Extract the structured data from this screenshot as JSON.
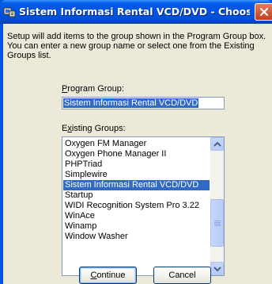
{
  "window": {
    "title": "Sistem Informasi Rental VCD/DVD - Choose Progr...",
    "close_label": "X"
  },
  "description": "Setup will add items to the group shown in the Program Group box. You can enter a new group name or select one from the Existing Groups list.",
  "program_group": {
    "label_prefix": "",
    "label_accel": "P",
    "label_rest": "rogram Group:",
    "value": "Sistem Informasi Rental VCD/DVD"
  },
  "existing_groups": {
    "label_prefix": "E",
    "label_accel": "x",
    "label_rest": "isting Groups:",
    "items": [
      {
        "label": "Oxygen FM Manager"
      },
      {
        "label": "Oxygen Phone Manager II"
      },
      {
        "label": "PHPTriad"
      },
      {
        "label": "Simplewire"
      },
      {
        "label": "Sistem Informasi Rental VCD/DVD"
      },
      {
        "label": "Startup"
      },
      {
        "label": "WIDI Recognition System Pro 3.22"
      },
      {
        "label": "WinAce"
      },
      {
        "label": "Winamp"
      },
      {
        "label": "Window Washer"
      }
    ],
    "selected_label": "Sistem Informasi Rental VCD/DVD"
  },
  "buttons": {
    "continue_accel": "C",
    "continue_rest": "ontinue",
    "cancel": "Cancel"
  },
  "colors": {
    "selection": "#316ac5",
    "titlebar": "#0054e3",
    "dialog": "#ece9d8"
  }
}
